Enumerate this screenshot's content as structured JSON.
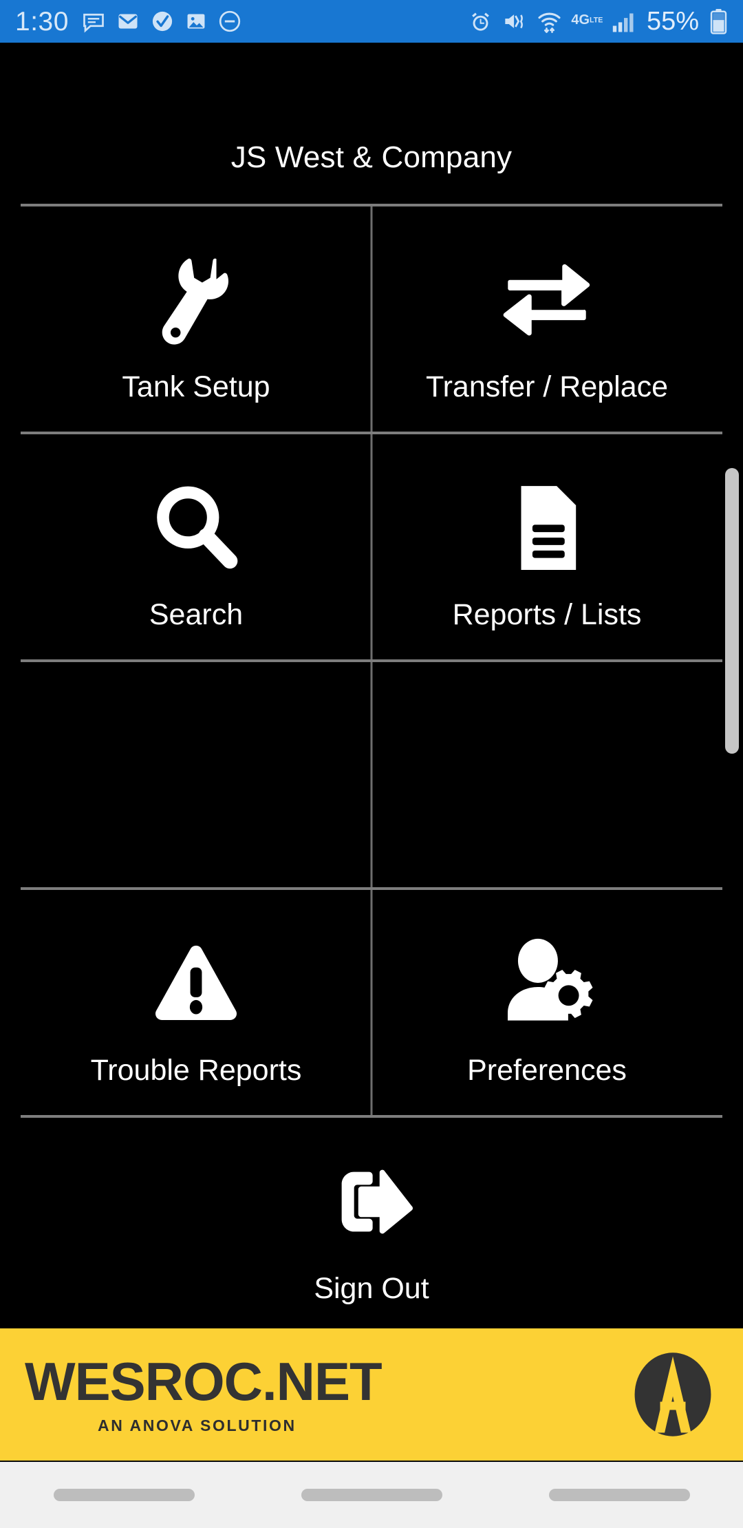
{
  "status_bar": {
    "time": "1:30",
    "battery_percent": "55%",
    "left_icons": [
      "chat-bubble-icon",
      "mail-icon",
      "check-circle-icon",
      "image-icon",
      "do-not-disturb-icon"
    ],
    "right_icons": [
      "alarm-icon",
      "mute-vibrate-icon",
      "wifi-icon",
      "4g-lte-icon",
      "signal-bars-icon"
    ],
    "network_label": "4G",
    "network_sublabel": "LTE",
    "background_color": "#1877d2"
  },
  "header": {
    "title": "JS West & Company"
  },
  "menu": {
    "rows": [
      {
        "cells": [
          {
            "label": "Tank Setup",
            "icon": "wrench-icon",
            "empty": false
          },
          {
            "label": "Transfer / Replace",
            "icon": "transfer-arrows-icon",
            "empty": false
          }
        ]
      },
      {
        "cells": [
          {
            "label": "Search",
            "icon": "magnifier-icon",
            "empty": false
          },
          {
            "label": "Reports / Lists",
            "icon": "document-icon",
            "empty": false
          }
        ]
      },
      {
        "cells": [
          {
            "label": "",
            "icon": "",
            "empty": true
          },
          {
            "label": "",
            "icon": "",
            "empty": true
          }
        ]
      },
      {
        "cells": [
          {
            "label": "Trouble Reports",
            "icon": "warning-triangle-icon",
            "empty": false
          },
          {
            "label": "Preferences",
            "icon": "user-gear-icon",
            "empty": false
          }
        ]
      }
    ],
    "sign_out": {
      "label": "Sign Out",
      "icon": "logout-icon"
    }
  },
  "footer": {
    "brand_name": "WESROC.NET",
    "tagline": "AN ANOVA SOLUTION",
    "logo_icon": "anova-circle-a-logo",
    "background_color": "#fcd135",
    "text_color": "#333333"
  },
  "navbar": {
    "pills": [
      "nav-pill-recents",
      "nav-pill-home",
      "nav-pill-back"
    ],
    "background_color": "#f0f0f0"
  },
  "scrollbar": {
    "visible": true
  }
}
